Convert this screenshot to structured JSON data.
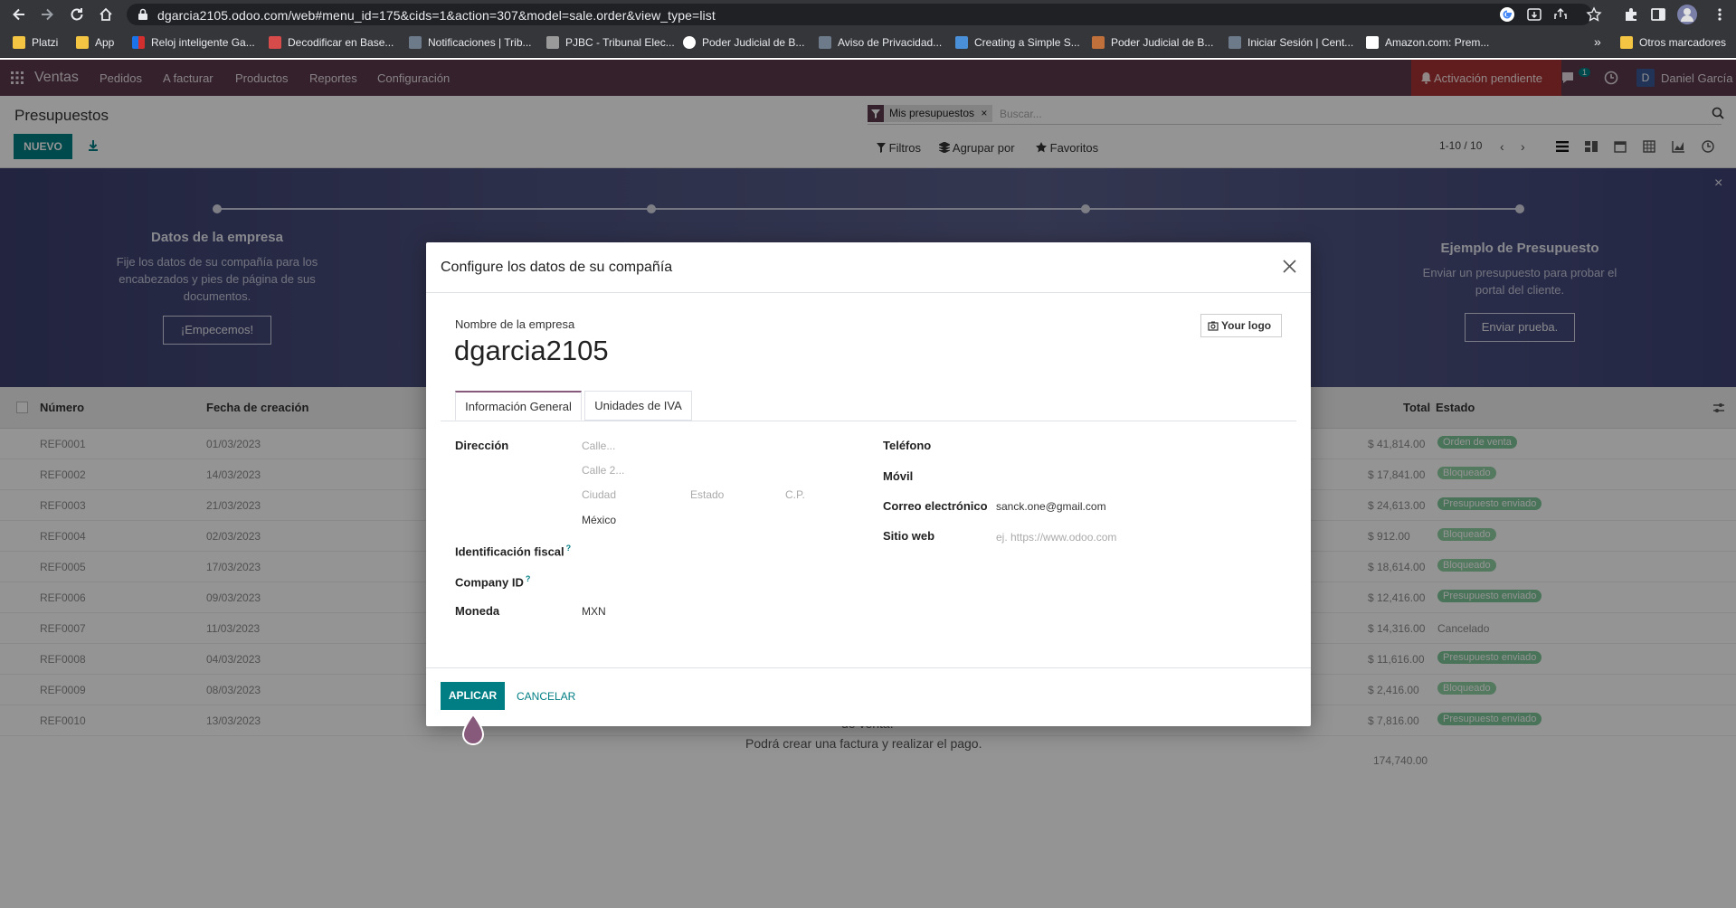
{
  "browser": {
    "url": "dgarcia2105.odoo.com/web#menu_id=175&cids=1&action=307&model=sale.order&view_type=list",
    "bookmarks": [
      "Platzi",
      "App",
      "Reloj inteligente Ga...",
      "Decodificar en Base...",
      "Notificaciones | Trib...",
      "PJBC - Tribunal Elec...",
      "Poder Judicial de B...",
      "Aviso de Privacidad...",
      "Creating a Simple S...",
      "Poder Judicial de B...",
      "Iniciar Sesión | Cent...",
      "Amazon.com: Prem..."
    ],
    "more_label": "»",
    "other_bookmarks": "Otros marcadores"
  },
  "navbar": {
    "app_name": "Ventas",
    "menu": [
      "Pedidos",
      "A facturar",
      "Productos",
      "Reportes",
      "Configuración"
    ],
    "activation": "Activación pendiente",
    "messages_count": "1",
    "user_initial": "D",
    "user_name": "Daniel García"
  },
  "control_panel": {
    "title": "Presupuestos",
    "new_button": "NUEVO",
    "facet": "Mis presupuestos",
    "facet_remove": "×",
    "search_placeholder": "Buscar...",
    "filters": "Filtros",
    "group_by": "Agrupar por",
    "favorites": "Favoritos",
    "pager": "1-10 / 10"
  },
  "banner": {
    "step1": {
      "title": "Datos de la empresa",
      "desc": "Fije los datos de su compañía para los encabezados y pies de página de sus documentos.",
      "button": "¡Empecemos!"
    },
    "step4": {
      "title": "Ejemplo de Presupuesto",
      "desc": "Enviar un presupuesto para probar el portal del cliente.",
      "button": "Enviar prueba."
    },
    "close": "×"
  },
  "list": {
    "columns": {
      "number": "Número",
      "date": "Fecha de creación",
      "total": "Total",
      "state": "Estado"
    },
    "rows": [
      {
        "ref": "REF0001",
        "date": "01/03/2023",
        "total": "$ 41,814.00",
        "state": "Orden de venta",
        "color": "#7fc89a"
      },
      {
        "ref": "REF0002",
        "date": "14/03/2023",
        "total": "$ 17,841.00",
        "state": "Bloqueado",
        "color": "#8fd0a4"
      },
      {
        "ref": "REF0003",
        "date": "21/03/2023",
        "total": "$ 24,613.00",
        "state": "Presupuesto enviado",
        "color": "#7fc89a"
      },
      {
        "ref": "REF0004",
        "date": "02/03/2023",
        "total": "$ 912.00",
        "state": "Bloqueado",
        "color": "#8fd0a4"
      },
      {
        "ref": "REF0005",
        "date": "17/03/2023",
        "total": "$ 18,614.00",
        "state": "Bloqueado",
        "color": "#8fd0a4"
      },
      {
        "ref": "REF0006",
        "date": "09/03/2023",
        "total": "$ 12,416.00",
        "state": "Presupuesto enviado",
        "color": "#7fc89a"
      },
      {
        "ref": "REF0007",
        "date": "11/03/2023",
        "total": "$ 14,316.00",
        "state": "Cancelado",
        "color": ""
      },
      {
        "ref": "REF0008",
        "date": "04/03/2023",
        "total": "$ 11,616.00",
        "state": "Presupuesto enviado",
        "color": "#7fc89a"
      },
      {
        "ref": "REF0009",
        "date": "08/03/2023",
        "total": "$ 2,416.00",
        "state": "Bloqueado",
        "color": "#8fd0a4"
      },
      {
        "ref": "REF0010",
        "date": "13/03/2023",
        "total": "$ 7,816.00",
        "state": "Presupuesto enviado",
        "color": "#7fc89a"
      }
    ],
    "grand_total": "174,740.00",
    "hint_line1": "de venta.",
    "hint_line2": "Podrá crear una factura y realizar el pago."
  },
  "modal": {
    "title": "Configure los datos de su compañía",
    "close": "×",
    "company_label": "Nombre de la empresa",
    "company_name": "dgarcia2105",
    "logo_button": "Your logo",
    "tabs": [
      "Información General",
      "Unidades de IVA"
    ],
    "address_label": "Dirección",
    "street_ph": "Calle...",
    "street2_ph": "Calle 2...",
    "city_ph": "Ciudad",
    "state_ph": "Estado",
    "zip_ph": "C.P.",
    "country": "México",
    "vat_label": "Identificación fiscal",
    "company_id_label": "Company ID",
    "help_mark": "?",
    "currency_label": "Moneda",
    "currency": "MXN",
    "phone_label": "Teléfono",
    "mobile_label": "Móvil",
    "email_label": "Correo electrónico",
    "email": "sanck.one@gmail.com",
    "website_label": "Sitio web",
    "website_ph": "ej. https://www.odoo.com",
    "apply": "APLICAR",
    "cancel": "CANCELAR"
  },
  "colors": {
    "odoo_purple": "#5a3a4b",
    "primary_teal": "#017e84",
    "activation_red": "#a83232",
    "cursor_drop": "#875a7b"
  }
}
